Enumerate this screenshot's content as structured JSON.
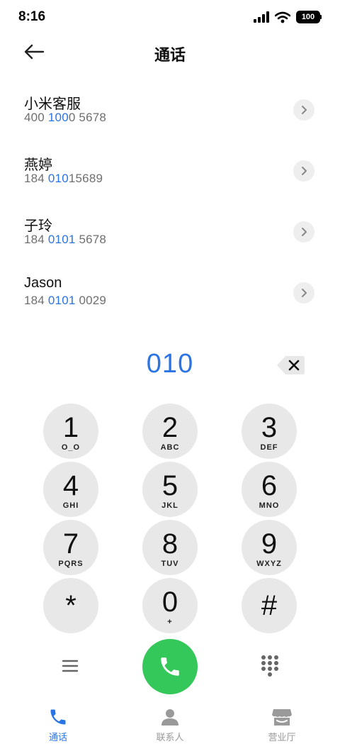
{
  "status_bar": {
    "time": "8:16",
    "battery": "100"
  },
  "header": {
    "title": "通话"
  },
  "contacts": [
    {
      "name": "小米客服",
      "number_parts": [
        "400 ",
        "100",
        "0 5678"
      ]
    },
    {
      "name": "燕婷",
      "number_parts": [
        "184 ",
        "010",
        "15689"
      ]
    },
    {
      "name": "子玲",
      "number_parts": [
        "184 ",
        "0101",
        " 5678"
      ]
    },
    {
      "name": "Jason",
      "number_parts": [
        "184 ",
        "0101",
        " 0029"
      ]
    }
  ],
  "dialer": {
    "input": "010"
  },
  "keypad": [
    {
      "digit": "1",
      "letters": "O_O"
    },
    {
      "digit": "2",
      "letters": "ABC"
    },
    {
      "digit": "3",
      "letters": "DEF"
    },
    {
      "digit": "4",
      "letters": "GHI"
    },
    {
      "digit": "5",
      "letters": "JKL"
    },
    {
      "digit": "6",
      "letters": "MNO"
    },
    {
      "digit": "7",
      "letters": "PQRS"
    },
    {
      "digit": "8",
      "letters": "TUV"
    },
    {
      "digit": "9",
      "letters": "WXYZ"
    },
    {
      "digit": "*",
      "letters": ""
    },
    {
      "digit": "0",
      "letters": "+"
    },
    {
      "digit": "#",
      "letters": ""
    }
  ],
  "tabs": [
    {
      "label": "通话",
      "active": true
    },
    {
      "label": "联系人",
      "active": false
    },
    {
      "label": "营业厅",
      "active": false
    }
  ],
  "colors": {
    "accent": "#2b74e4",
    "call_green": "#34c759",
    "key_bg": "#e8e8e8",
    "muted": "#9a9a9a"
  },
  "icons": {
    "back": "arrow-left-icon",
    "chevron": "chevron-right-icon",
    "backspace": "backspace-icon",
    "menu": "menu-icon",
    "call": "phone-icon",
    "dialpad": "dialpad-icon"
  }
}
